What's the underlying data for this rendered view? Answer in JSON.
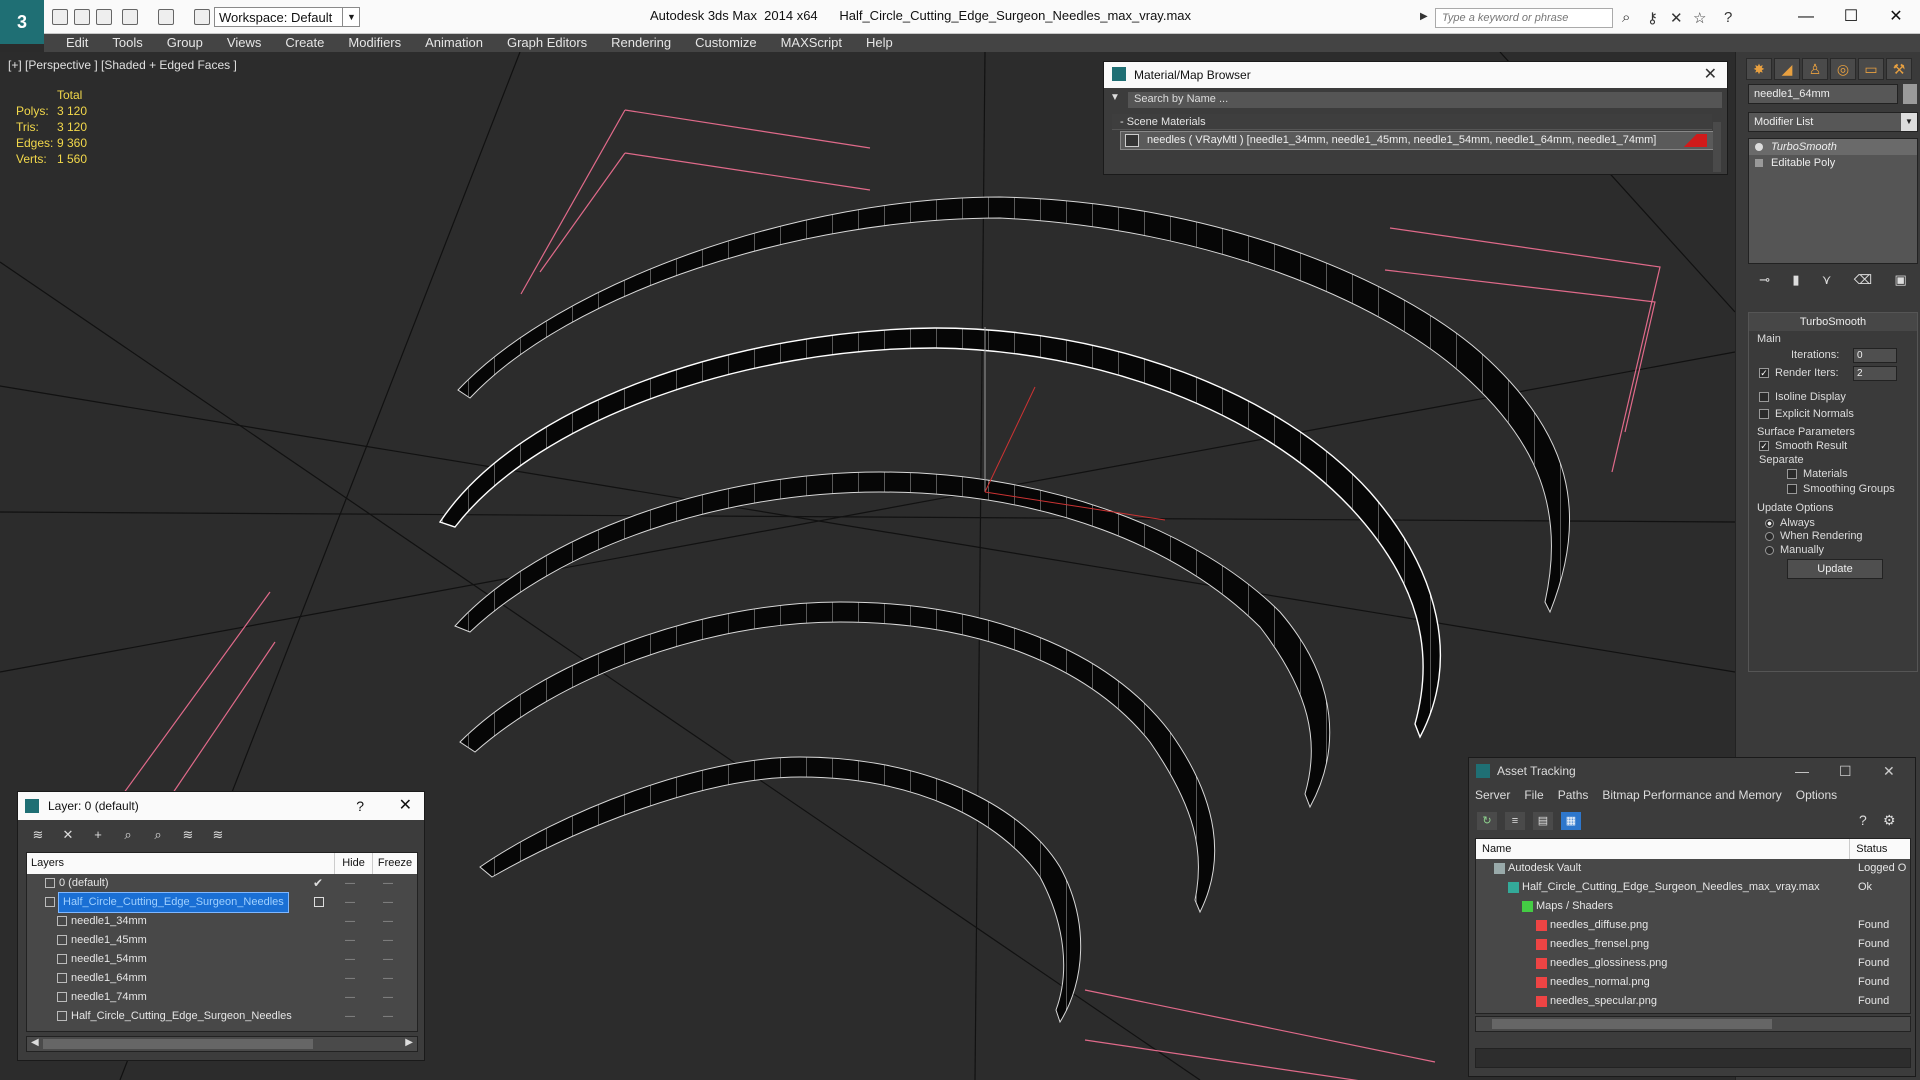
{
  "titlebar": {
    "app_title": "Autodesk 3ds Max  2014 x64      Half_Circle_Cutting_Edge_Surgeon_Needles_max_vray.max",
    "workspace": "Workspace: Default",
    "search_placeholder": "Type a keyword or phrase"
  },
  "menu": [
    "Edit",
    "Tools",
    "Group",
    "Views",
    "Create",
    "Modifiers",
    "Animation",
    "Graph Editors",
    "Rendering",
    "Customize",
    "MAXScript",
    "Help"
  ],
  "viewport": {
    "label": "[+] [Perspective ] [Shaded + Edged Faces ]",
    "stats": {
      "header": "Total",
      "rows": [
        {
          "k": "Polys:",
          "v": "3 120"
        },
        {
          "k": "Tris:",
          "v": "3 120"
        },
        {
          "k": "Edges:",
          "v": "9 360"
        },
        {
          "k": "Verts:",
          "v": "1 560"
        }
      ]
    }
  },
  "command_panel": {
    "object_name": "needle1_64mm",
    "modifier_list": "Modifier List",
    "stack": [
      "TurboSmooth",
      "Editable Poly"
    ],
    "turbosmooth": {
      "title": "TurboSmooth",
      "main": "Main",
      "iterations_label": "Iterations:",
      "iterations": "0",
      "render_iters_label": "Render Iters:",
      "render_iters": "2",
      "isoline": "Isoline Display",
      "explicit": "Explicit Normals",
      "surface": "Surface Parameters",
      "smooth_result": "Smooth Result",
      "separate": "Separate",
      "materials": "Materials",
      "smoothing_groups": "Smoothing Groups",
      "update_options": "Update Options",
      "always": "Always",
      "when_rendering": "When Rendering",
      "manually": "Manually",
      "update": "Update"
    }
  },
  "material_browser": {
    "title": "Material/Map Browser",
    "search": "Search by Name ...",
    "section": "- Scene Materials",
    "row": "needles  ( VRayMtl )  [needle1_34mm, needle1_45mm, needle1_54mm, needle1_64mm, needle1_74mm]"
  },
  "layer_dialog": {
    "title": "Layer: 0 (default)",
    "help": "?",
    "columns": [
      "Layers",
      "Hide",
      "Freeze"
    ],
    "rows": [
      {
        "name": "0 (default)",
        "indent": 0,
        "check": true
      },
      {
        "name": "Half_Circle_Cutting_Edge_Surgeon_Needles",
        "indent": 0,
        "selected": true
      },
      {
        "name": "needle1_34mm",
        "indent": 1
      },
      {
        "name": "needle1_45mm",
        "indent": 1
      },
      {
        "name": "needle1_54mm",
        "indent": 1
      },
      {
        "name": "needle1_64mm",
        "indent": 1
      },
      {
        "name": "needle1_74mm",
        "indent": 1
      },
      {
        "name": "Half_Circle_Cutting_Edge_Surgeon_Needles",
        "indent": 1
      }
    ]
  },
  "asset_tracking": {
    "title": "Asset Tracking",
    "menu": [
      "Server",
      "File",
      "Paths",
      "Bitmap Performance and Memory",
      "Options"
    ],
    "columns": [
      "Name",
      "Status"
    ],
    "rows": [
      {
        "name": "Autodesk Vault",
        "status": "Logged O",
        "indent": 1,
        "icon": "vault"
      },
      {
        "name": "Half_Circle_Cutting_Edge_Surgeon_Needles_max_vray.max",
        "status": "Ok",
        "indent": 2,
        "icon": "max"
      },
      {
        "name": "Maps / Shaders",
        "status": "",
        "indent": 3,
        "icon": "maps"
      },
      {
        "name": "needles_diffuse.png",
        "status": "Found",
        "indent": 4,
        "icon": "png"
      },
      {
        "name": "needles_frensel.png",
        "status": "Found",
        "indent": 4,
        "icon": "png"
      },
      {
        "name": "needles_glossiness.png",
        "status": "Found",
        "indent": 4,
        "icon": "png"
      },
      {
        "name": "needles_normal.png",
        "status": "Found",
        "indent": 4,
        "icon": "png"
      },
      {
        "name": "needles_specular.png",
        "status": "Found",
        "indent": 4,
        "icon": "png"
      }
    ]
  }
}
